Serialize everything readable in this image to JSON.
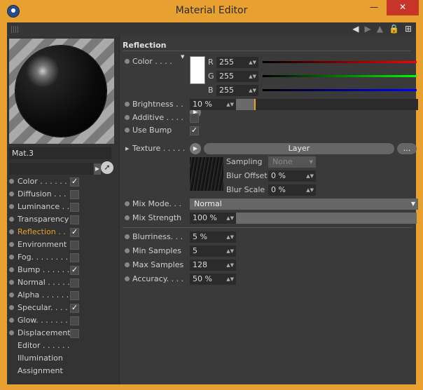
{
  "window": {
    "title": "Material Editor",
    "min_icon": "minimize-icon",
    "max_icon": "maximize-icon",
    "close_icon": "close-icon"
  },
  "material": {
    "name": "Mat.3"
  },
  "channels": [
    {
      "label": "Color . . . . . .",
      "checked": true,
      "dot": true
    },
    {
      "label": "Diffusion . . .",
      "checked": false,
      "dot": true
    },
    {
      "label": "Luminance . .",
      "checked": false,
      "dot": true
    },
    {
      "label": "Transparency",
      "checked": false,
      "dot": true
    },
    {
      "label": "Reflection . .",
      "checked": true,
      "dot": true,
      "active": true
    },
    {
      "label": "Environment",
      "checked": false,
      "dot": true
    },
    {
      "label": "Fog. . . . . . . .",
      "checked": false,
      "dot": true
    },
    {
      "label": "Bump . . . . . .",
      "checked": true,
      "dot": true
    },
    {
      "label": "Normal . . . . .",
      "checked": false,
      "dot": true
    },
    {
      "label": "Alpha . . . . . .",
      "checked": false,
      "dot": true
    },
    {
      "label": "Specular. . . .",
      "checked": true,
      "dot": true
    },
    {
      "label": "Glow. . . . . . .",
      "checked": false,
      "dot": true
    },
    {
      "label": "Displacement",
      "checked": false,
      "dot": true
    },
    {
      "label": "Editor . . . . . .",
      "dot": false
    },
    {
      "label": "Illumination",
      "dot": false
    },
    {
      "label": "Assignment",
      "dot": false
    }
  ],
  "reflection": {
    "section_title": "Reflection",
    "color_label": "Color . . . .",
    "r_label": "R",
    "g_label": "G",
    "b_label": "B",
    "r": "255",
    "g": "255",
    "b": "255",
    "brightness_label": "Brightness . .",
    "brightness": "10 %",
    "brightness_fraction": 0.1,
    "additive_label": "Additive . . . .",
    "use_bump_label": "Use Bump",
    "texture_label": "Texture . . . . .",
    "texture_button": "Layer",
    "more_button": "...",
    "sampling_label": "Sampling",
    "sampling_value": "None",
    "blur_offset_label": "Blur Offset",
    "blur_offset": "0 %",
    "blur_scale_label": "Blur Scale",
    "blur_scale": "0 %",
    "mix_mode_label": "Mix Mode. . .",
    "mix_mode": "Normal",
    "mix_strength_label": "Mix Strength",
    "mix_strength": "100 %",
    "mix_strength_fraction": 1.0,
    "blurriness_label": "Blurriness. . .",
    "blurriness": "5 %",
    "min_samples_label": "Min Samples",
    "min_samples": "5",
    "max_samples_label": "Max Samples",
    "max_samples": "128",
    "accuracy_label": "Accuracy. . . .",
    "accuracy": "50 %"
  }
}
